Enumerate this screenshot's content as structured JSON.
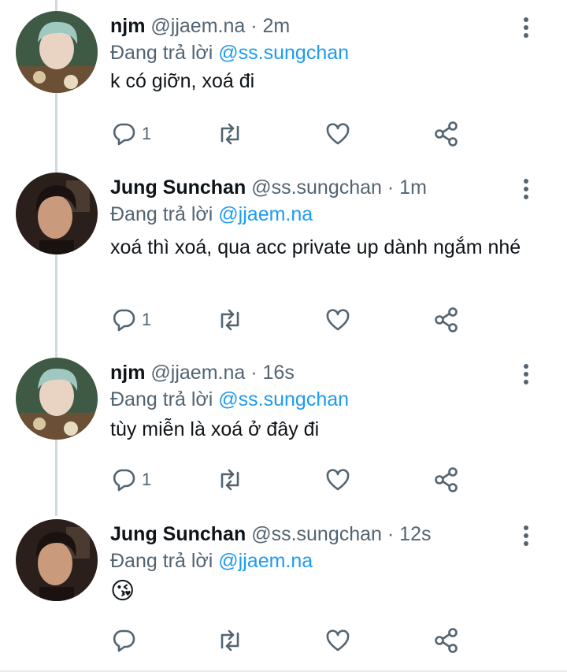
{
  "tweets": [
    {
      "name": "njm",
      "handle": "@jjaem.na",
      "separator": "·",
      "time": "2m",
      "reply_prefix": "Đang trả lời",
      "reply_to": "@ss.sungchan",
      "text": "k có giỡn, xoá đi",
      "reply_count": "1"
    },
    {
      "name": "Jung Sunchan",
      "handle": "@ss.sungchan",
      "separator": "·",
      "time": "1m",
      "reply_prefix": "Đang trả lời",
      "reply_to": "@jjaem.na",
      "text": "xoá thì xoá, qua acc private up dành ngắm nhé",
      "reply_count": "1"
    },
    {
      "name": "njm",
      "handle": "@jjaem.na",
      "separator": "·",
      "time": "16s",
      "reply_prefix": "Đang trả lời",
      "reply_to": "@ss.sungchan",
      "text": "tùy miễn là xoá ở đây đi",
      "reply_count": "1"
    },
    {
      "name": "Jung Sunchan",
      "handle": "@ss.sungchan",
      "separator": "·",
      "time": "12s",
      "reply_prefix": "Đang trả lời",
      "reply_to": "@jjaem.na",
      "text": "😘",
      "reply_count": ""
    }
  ],
  "icons": {
    "reply": "reply-icon",
    "retweet": "retweet-icon",
    "like": "heart-icon",
    "share": "share-icon",
    "more": "more-vertical-icon"
  },
  "colors": {
    "mention": "#1d9bf0",
    "secondary_text": "#536471",
    "icon": "#536471",
    "thread_line": "#cfd9de"
  }
}
